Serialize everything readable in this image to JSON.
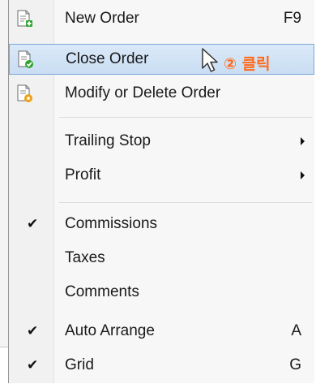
{
  "menu": {
    "items": [
      {
        "label": "New Order",
        "shortcut": "F9",
        "icon": "new-order-icon"
      },
      {
        "label": "Close Order",
        "icon": "close-order-icon"
      },
      {
        "label": "Modify or Delete Order",
        "icon": "modify-order-icon"
      },
      {
        "label": "Trailing Stop",
        "submenu": true
      },
      {
        "label": "Profit",
        "submenu": true
      },
      {
        "label": "Commissions",
        "checked": true,
        "check_mark": "✔"
      },
      {
        "label": "Taxes",
        "checked": false
      },
      {
        "label": "Comments",
        "checked": false
      },
      {
        "label": "Auto Arrange",
        "checked": true,
        "shortcut": "A",
        "check_mark": "✔"
      },
      {
        "label": "Grid",
        "checked": true,
        "shortcut": "G",
        "check_mark": "✔"
      }
    ]
  },
  "annotation": {
    "text": "② 클릭",
    "color": "#ff6a1a"
  },
  "colors": {
    "highlight": "#c9ddf3",
    "highlight_border": "#7ca6d9"
  }
}
